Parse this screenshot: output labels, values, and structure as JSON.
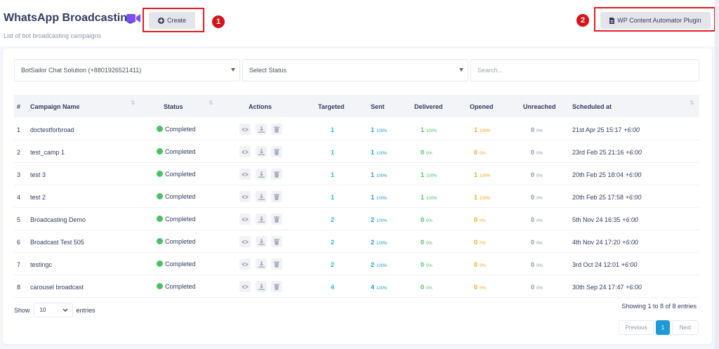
{
  "header": {
    "title": "WhatsApp Broadcasting",
    "subtitle": "List of bot broadcasting campaigns",
    "create_label": "Create",
    "wp_label": "WP Content Automator Plugin",
    "badge_1": "1",
    "badge_2": "2"
  },
  "filters": {
    "account": "BotSailor Chat Solution (+8801926521411)",
    "status_placeholder": "Select Status",
    "search_placeholder": "Search..."
  },
  "table": {
    "columns": {
      "num": "#",
      "campaign": "Campaign Name",
      "status": "Status",
      "actions": "Actions",
      "targeted": "Targeted",
      "sent": "Sent",
      "delivered": "Delivered",
      "opened": "Opened",
      "unreached": "Unreached",
      "scheduled": "Scheduled at"
    },
    "rows": [
      {
        "num": "1",
        "name": "doctestforbroad",
        "status": "Completed",
        "targeted": "1",
        "sent": "1",
        "sent_pct": "100%",
        "delivered": "1",
        "delivered_pct": "100%",
        "opened": "1",
        "opened_pct": "100%",
        "unreached": "0",
        "unreached_pct": "0%",
        "sched": "21st Apr 25 15:17",
        "tz": "+6:00"
      },
      {
        "num": "2",
        "name": "test_camp 1",
        "status": "Completed",
        "targeted": "1",
        "sent": "1",
        "sent_pct": "100%",
        "delivered": "0",
        "delivered_pct": "0%",
        "opened": "0",
        "opened_pct": "0%",
        "unreached": "0",
        "unreached_pct": "0%",
        "sched": "23rd Feb 25 21:16",
        "tz": "+6:00"
      },
      {
        "num": "3",
        "name": "test 3",
        "status": "Completed",
        "targeted": "1",
        "sent": "1",
        "sent_pct": "100%",
        "delivered": "1",
        "delivered_pct": "100%",
        "opened": "1",
        "opened_pct": "100%",
        "unreached": "0",
        "unreached_pct": "0%",
        "sched": "20th Feb 25 18:04",
        "tz": "+6:00"
      },
      {
        "num": "4",
        "name": "test 2",
        "status": "Completed",
        "targeted": "1",
        "sent": "1",
        "sent_pct": "100%",
        "delivered": "1",
        "delivered_pct": "100%",
        "opened": "1",
        "opened_pct": "100%",
        "unreached": "0",
        "unreached_pct": "0%",
        "sched": "20th Feb 25 17:58",
        "tz": "+6:00"
      },
      {
        "num": "5",
        "name": "Broadcasting Demo",
        "status": "Completed",
        "targeted": "2",
        "sent": "2",
        "sent_pct": "100%",
        "delivered": "0",
        "delivered_pct": "0%",
        "opened": "0",
        "opened_pct": "0%",
        "unreached": "0",
        "unreached_pct": "0%",
        "sched": "5th Nov 24 16:35",
        "tz": "+6:00"
      },
      {
        "num": "6",
        "name": "Broadcast Test 505",
        "status": "Completed",
        "targeted": "2",
        "sent": "2",
        "sent_pct": "100%",
        "delivered": "0",
        "delivered_pct": "0%",
        "opened": "0",
        "opened_pct": "0%",
        "unreached": "0",
        "unreached_pct": "0%",
        "sched": "4th Nov 24 17:20",
        "tz": "+6:00"
      },
      {
        "num": "7",
        "name": "testingc",
        "status": "Completed",
        "targeted": "2",
        "sent": "2",
        "sent_pct": "100%",
        "delivered": "0",
        "delivered_pct": "0%",
        "opened": "0",
        "opened_pct": "0%",
        "unreached": "0",
        "unreached_pct": "0%",
        "sched": "3rd Oct 24 12:01",
        "tz": "+6:00"
      },
      {
        "num": "8",
        "name": "carousel broadcast",
        "status": "Completed",
        "targeted": "4",
        "sent": "4",
        "sent_pct": "100%",
        "delivered": "0",
        "delivered_pct": "0%",
        "opened": "0",
        "opened_pct": "0%",
        "unreached": "0",
        "unreached_pct": "0%",
        "sched": "30th Sep 24 17:47",
        "tz": "+6:00"
      }
    ]
  },
  "footer": {
    "show_label": "Show",
    "entries_value": "10",
    "entries_label": "entries",
    "info": "Showing 1 to 8 of 8 entries",
    "prev_label": "Previous",
    "page_1": "1",
    "next_label": "Next"
  },
  "icons": {
    "video": "video-camera-icon",
    "create": "plus-circle-icon",
    "wp": "file-icon",
    "view": "eye-icon",
    "download": "download-icon",
    "delete": "trash-icon"
  },
  "colors": {
    "completed": "#47c363",
    "highlight": "#e11c24",
    "active_page": "#1e9ad6",
    "video_icon": "#7b4ef2"
  }
}
